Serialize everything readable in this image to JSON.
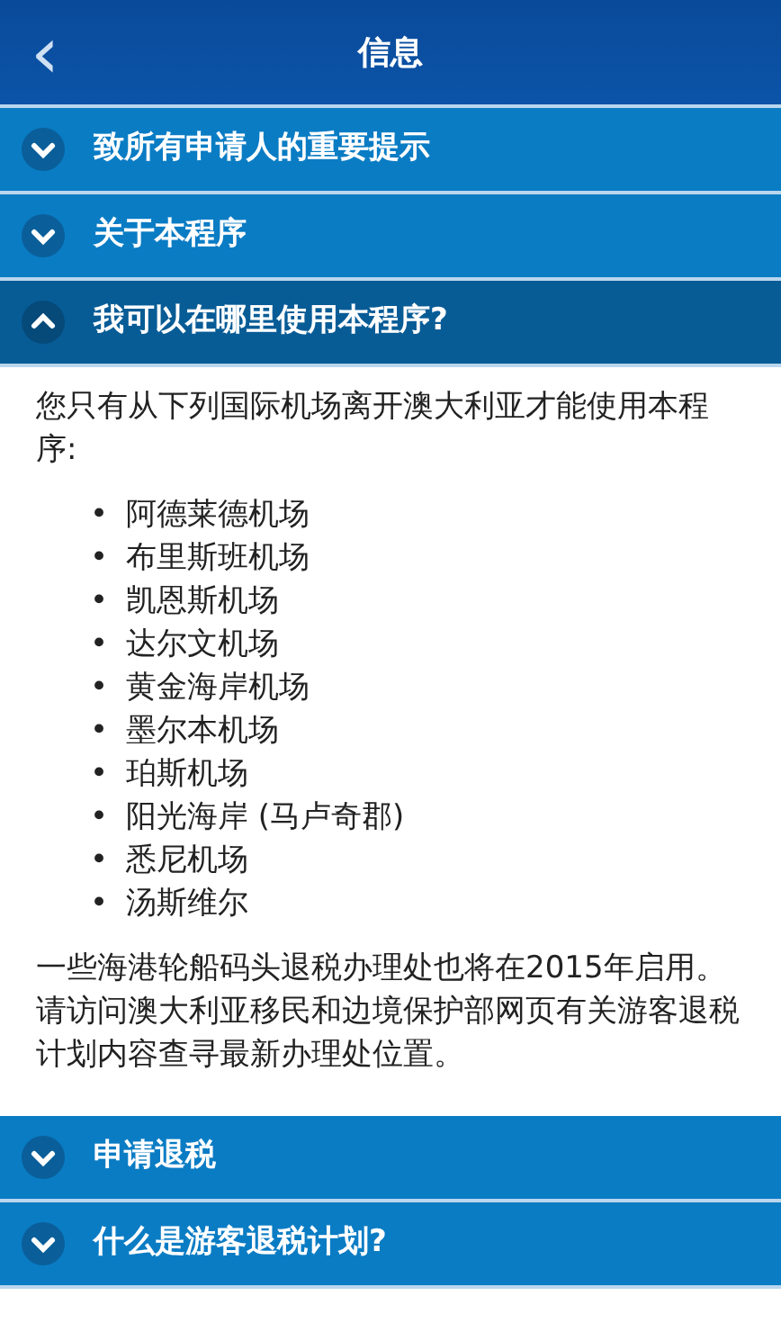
{
  "header": {
    "back": "‹",
    "title": "信息"
  },
  "sections": [
    {
      "title": "致所有申请人的重要提示",
      "expanded": false
    },
    {
      "title": "关于本程序",
      "expanded": false
    },
    {
      "title": "我可以在哪里使用本程序?",
      "expanded": true,
      "bullet": "•",
      "intro": "您只有从下列国际机场离开澳大利亚才能使用本程序:",
      "items": [
        "阿德莱德机场",
        "布里斯班机场",
        "凯恩斯机场",
        "达尔文机场",
        "黄金海岸机场",
        "墨尔本机场",
        "珀斯机场",
        "阳光海岸 (马卢奇郡)",
        "悉尼机场",
        "汤斯维尔"
      ],
      "note": "一些海港轮船码头退税办理处也将在2015年启用。请访问澳大利亚移民和边境保护部网页有关游客退税计划内容查寻最新办理处位置。"
    },
    {
      "title": "申请退税",
      "expanded": false
    },
    {
      "title": "什么是游客退税计划?",
      "expanded": false
    }
  ]
}
